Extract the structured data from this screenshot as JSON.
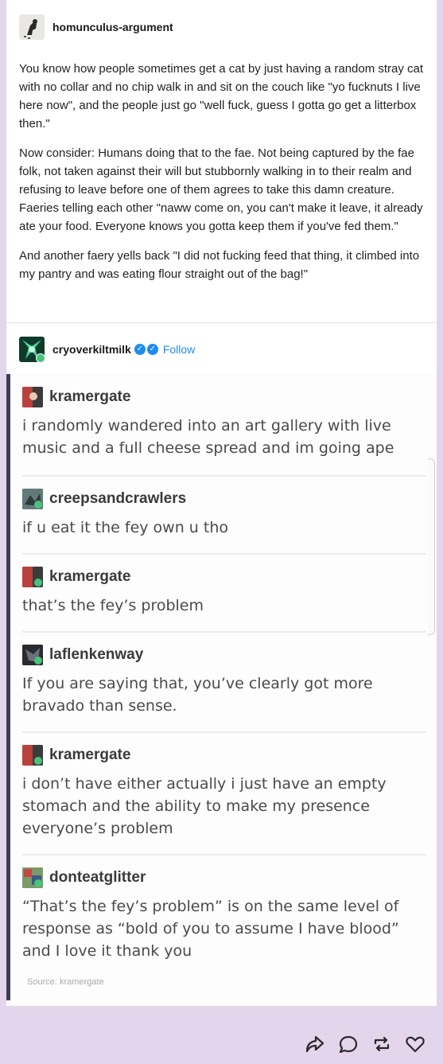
{
  "post": {
    "op": {
      "username": "homunculus-argument",
      "paragraphs": [
        " You know how people sometimes get a cat by just having a random stray cat with no collar and no chip walk in and sit on the couch like \"yo fucknuts I live here now\", and the people just go \"well fuck, guess I gotta go get a litterbox then.\"",
        "Now consider: Humans doing that to the fae. Not being captured by the fae folk, not taken against their will but stubbornly walking in to their realm and refusing to leave before one of them agrees to take this damn creature. Faeries telling each other \"naww come on, you can't make it leave, it already ate your food. Everyone knows you gotta keep them if you've fed them.\"",
        " And another faery yells back \"I did not fucking feed that thing, it climbed into my pantry and was eating flour straight out of the bag!\""
      ]
    },
    "reblogger": {
      "username": "cryoverkiltmilk",
      "follow_label": "Follow",
      "badge_icons": [
        "verified-icon",
        "verified-icon"
      ]
    },
    "screenshot_thread": [
      {
        "username": "kramergate",
        "text": "i randomly wandered into an art gallery with live music and a full cheese spread and im going ape"
      },
      {
        "username": "creepsandcrawlers",
        "text": "if u eat it the fey own u tho"
      },
      {
        "username": "kramergate",
        "text": "that’s the fey’s problem"
      },
      {
        "username": "laflenkenway",
        "text": "If you are saying that, you’ve clearly got more bravado than sense."
      },
      {
        "username": "kramergate",
        "text": "i don’t have either actually i just have an empty stomach and the ability to make my presence everyone’s problem"
      },
      {
        "username": "donteatglitter",
        "text": "“That’s the fey’s problem” is on the same level of response as “bold of you to assume I have blood” and I love it thank you"
      }
    ],
    "source_label": "Source: kramergate",
    "actions": [
      "share-icon",
      "reply-icon",
      "reblog-icon",
      "like-icon"
    ]
  },
  "colors": {
    "page_bg": "#e3d5ec",
    "accent_blue": "#1d8cf0",
    "reblog_bar": "#3d3d52"
  }
}
